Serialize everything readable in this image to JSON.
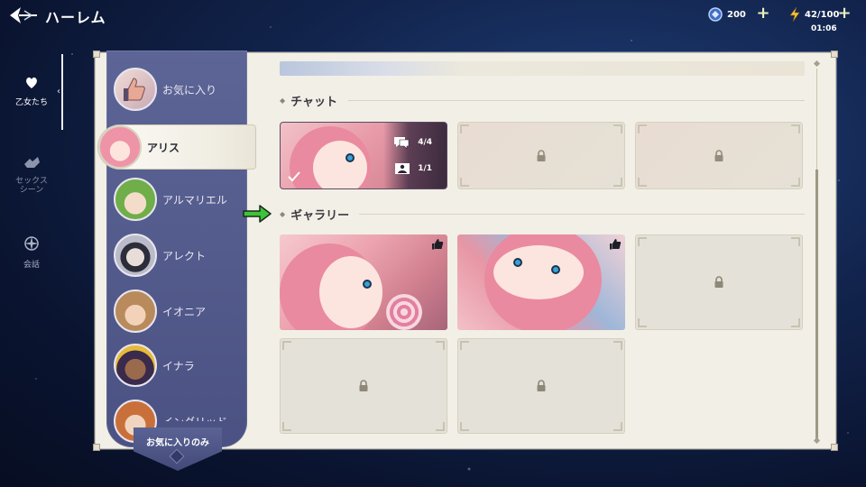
{
  "header": {
    "title": "ハーレム",
    "gems": "200",
    "energy": "42/100",
    "timer": "01:06"
  },
  "nav": {
    "items": [
      {
        "label": "乙女たち",
        "icon": "heart-flower-icon",
        "active": true
      },
      {
        "label": "セックス\nシーン",
        "icon": "scene-icon",
        "active": false
      },
      {
        "label": "会話",
        "icon": "compass-icon",
        "active": false
      }
    ]
  },
  "characters": [
    {
      "name": "お気に入り",
      "type": "favorites"
    },
    {
      "name": "アリス",
      "selected": true
    },
    {
      "name": "アルマリエル"
    },
    {
      "name": "アレクト"
    },
    {
      "name": "イオニア"
    },
    {
      "name": "イナラ"
    },
    {
      "name": "イングリッド"
    }
  ],
  "filter": {
    "label": "お気に入りのみ"
  },
  "sections": {
    "chat": {
      "title": "チャット",
      "cards": [
        {
          "state": "unlocked",
          "chats": "4/4",
          "images": "1/1",
          "completed": true
        },
        {
          "state": "locked"
        },
        {
          "state": "locked"
        }
      ]
    },
    "gallery": {
      "title": "ギャラリー",
      "cards": [
        {
          "state": "unlocked",
          "liked": true
        },
        {
          "state": "unlocked",
          "liked": true
        },
        {
          "state": "locked"
        },
        {
          "state": "locked"
        },
        {
          "state": "locked"
        }
      ]
    }
  },
  "colors": {
    "panel_bg": "#f2efe6",
    "list_bg": "#5c6596",
    "accent_green": "#3ec43a"
  }
}
